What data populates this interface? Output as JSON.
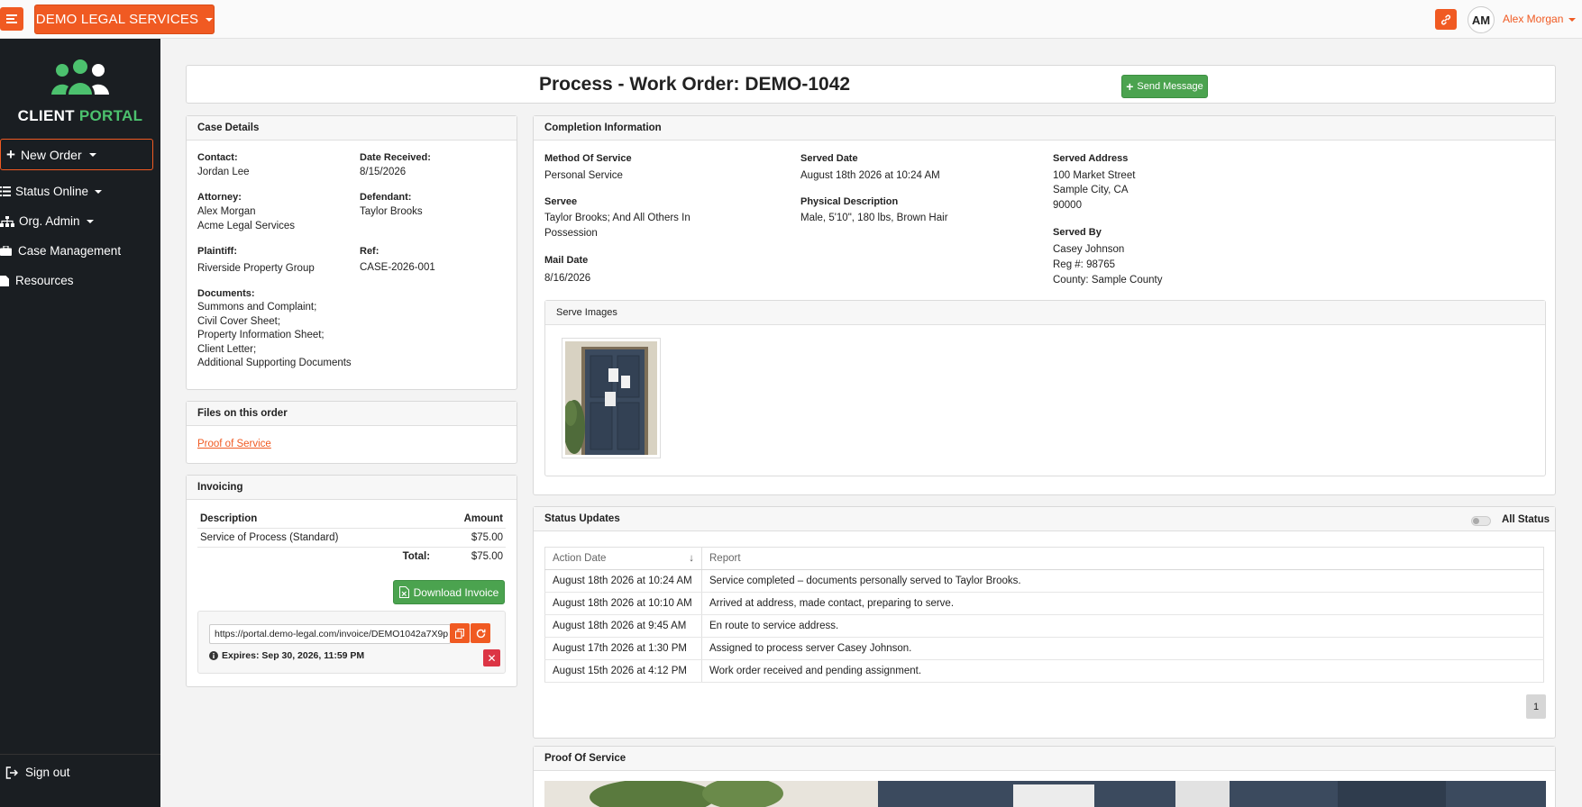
{
  "topbar": {
    "brand": "DEMO LEGAL SERVICES",
    "avatar_initials": "AM",
    "user_name": "Alex Morgan"
  },
  "sidebar": {
    "logo_left": "CLIENT",
    "logo_right": "PORTAL",
    "new_order": "New Order",
    "items": [
      {
        "label": "Status Online",
        "icon": "list-icon"
      },
      {
        "label": "Org. Admin",
        "icon": "sitemap-icon"
      },
      {
        "label": "Case Management",
        "icon": "briefcase-icon"
      },
      {
        "label": "Resources",
        "icon": "file-icon"
      }
    ],
    "sign_out": "Sign out"
  },
  "header": {
    "title": "Process - Work Order: DEMO-1042",
    "send_message": "Send Message"
  },
  "case_details": {
    "heading": "Case Details",
    "contact_label": "Contact:",
    "contact": "Jordan Lee",
    "date_received_label": "Date Received:",
    "date_received": "8/15/2026",
    "attorney_label": "Attorney:",
    "attorney_name": "Alex Morgan",
    "attorney_firm": "Acme Legal Services",
    "defendant_label": "Defendant:",
    "defendant": "Taylor Brooks",
    "plaintiff_label": "Plaintiff:",
    "plaintiff": "Riverside Property Group",
    "ref_label": "Ref:",
    "ref": "CASE-2026-001",
    "documents_label": "Documents:",
    "documents": [
      "Summons and Complaint;",
      "Civil Cover Sheet;",
      "Property Information Sheet;",
      "Client Letter;",
      "Additional Supporting Documents"
    ]
  },
  "files": {
    "heading": "Files on this order",
    "link": "Proof of Service"
  },
  "invoicing": {
    "heading": "Invoicing",
    "col_description": "Description",
    "col_amount": "Amount",
    "item_description": "Service of Process (Standard)",
    "item_amount": "$75.00",
    "total_label": "Total:",
    "total": "$75.00",
    "download": "Download Invoice",
    "url": "https://portal.demo-legal.com/invoice/DEMO1042a7X9p",
    "expires": "Expires: Sep 30, 2026, 11:59 PM"
  },
  "completion": {
    "heading": "Completion Information",
    "method_label": "Method Of Service",
    "method": "Personal Service",
    "servee_label": "Servee",
    "servee_line1": "Taylor Brooks; And All Others In",
    "servee_line2": "Possession",
    "mail_date_label": "Mail Date",
    "mail_date": "8/16/2026",
    "served_date_label": "Served Date",
    "served_date": "August 18th 2026 at 10:24 AM",
    "physical_label": "Physical Description",
    "physical": "Male, 5'10\", 180 lbs, Brown Hair",
    "address_label": "Served Address",
    "address_line1": "100 Market Street",
    "address_line2": "Sample City, CA",
    "address_line3": "90000",
    "served_by_label": "Served By",
    "served_by_name": "Casey Johnson",
    "served_by_reg": "Reg #: 98765",
    "served_by_county": "County: Sample County",
    "images_heading": "Serve Images"
  },
  "status_updates": {
    "heading": "Status Updates",
    "toggle_label": "All Status",
    "col_date": "Action Date",
    "col_report": "Report",
    "rows": [
      {
        "date": "August 18th 2026 at 10:24 AM",
        "report": "Service completed – documents personally served to Taylor Brooks."
      },
      {
        "date": "August 18th 2026 at 10:10 AM",
        "report": "Arrived at address, made contact, preparing to serve."
      },
      {
        "date": "August 18th 2026 at 9:45 AM",
        "report": "En route to service address."
      },
      {
        "date": "August 17th 2026 at 1:30 PM",
        "report": "Assigned to process server Casey Johnson."
      },
      {
        "date": "August 15th 2026 at 4:12 PM",
        "report": "Work order received and pending assignment."
      }
    ],
    "page": "1"
  },
  "proof": {
    "heading": "Proof Of Service"
  },
  "colors": {
    "accent": "#f05a22",
    "success": "#4ba34f",
    "sidebar": "#1a1e22",
    "logo_green": "#4cc16e"
  }
}
